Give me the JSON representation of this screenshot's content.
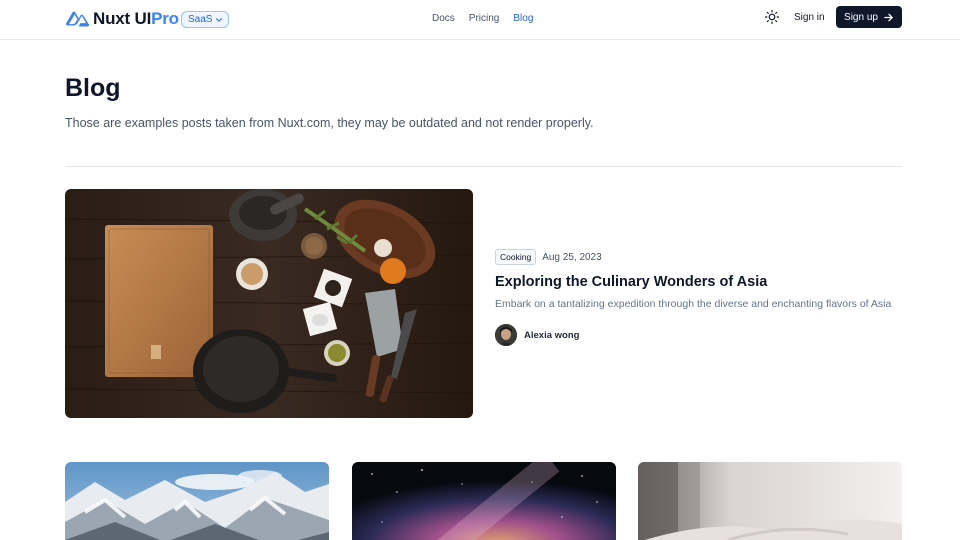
{
  "header": {
    "logo_text": "Nuxt UI",
    "logo_pro": "Pro",
    "badge": "SaaS",
    "nav": [
      {
        "label": "Docs"
      },
      {
        "label": "Pricing"
      },
      {
        "label": "Blog",
        "active": true
      }
    ],
    "theme_icon": "sun-icon",
    "signin": "Sign in",
    "signup": "Sign up"
  },
  "page": {
    "title": "Blog",
    "description": "Those are examples posts taken from Nuxt.com, they may be outdated and not render properly."
  },
  "featured": {
    "tag": "Cooking",
    "date": "Aug 25, 2023",
    "title": "Exploring the Culinary Wonders of Asia",
    "description": "Embark on a tantalizing expedition through the diverse and enchanting flavors of Asia",
    "author": "Alexia wong"
  },
  "cards": [
    {
      "image": "mountains"
    },
    {
      "image": "milky-way"
    },
    {
      "image": "bedding"
    }
  ],
  "colors": {
    "accent": "#2563eb",
    "dark_button": "#0f172a"
  }
}
